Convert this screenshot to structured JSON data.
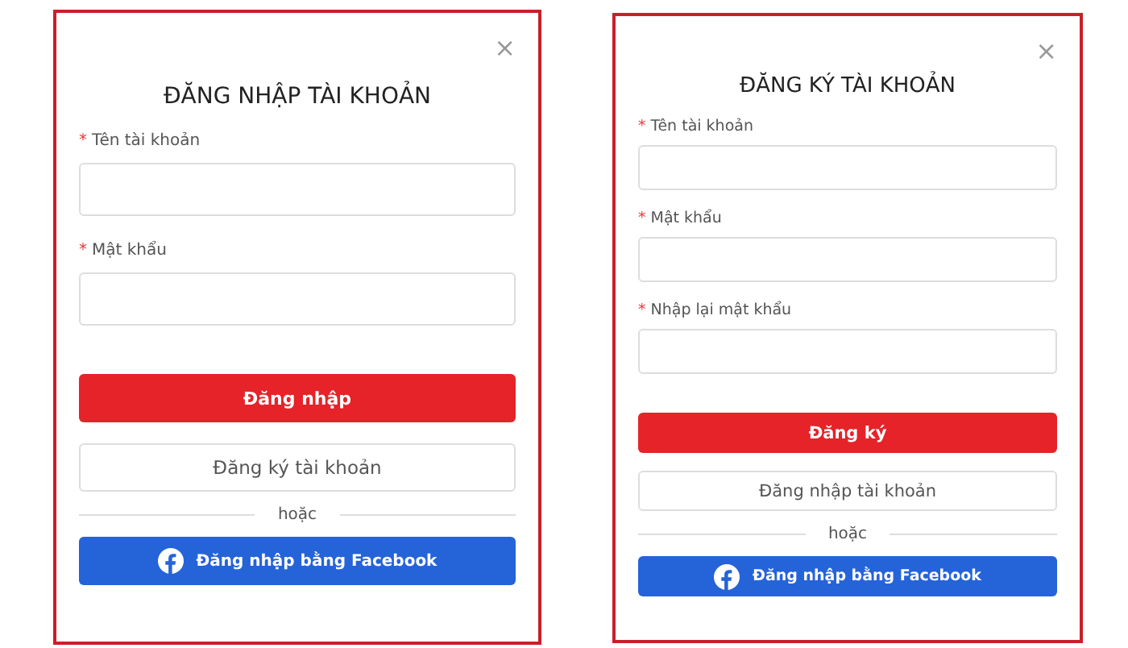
{
  "forms": [
    {
      "close": "×",
      "title": "ĐĂNG NHẬP TÀI KHOẢN",
      "fields": [
        {
          "required_mark": "*",
          "label": "Tên tài khoản"
        },
        {
          "required_mark": "*",
          "label": "Mật khẩu"
        }
      ],
      "primary_button": "Đăng nhập",
      "secondary_button": "Đăng ký tài khoản",
      "divider_text": "hoặc",
      "facebook_button": "Đăng nhập bằng Facebook"
    },
    {
      "close": "×",
      "title": "ĐĂNG KÝ TÀI KHOẢN",
      "fields": [
        {
          "required_mark": "*",
          "label": "Tên tài khoản"
        },
        {
          "required_mark": "*",
          "label": "Mật khẩu"
        },
        {
          "required_mark": "*",
          "label": "Nhập lại mật khẩu"
        }
      ],
      "primary_button": "Đăng ký",
      "secondary_button": "Đăng nhập tài khoản",
      "divider_text": "hoặc",
      "facebook_button": "Đăng nhập bằng Facebook"
    }
  ]
}
